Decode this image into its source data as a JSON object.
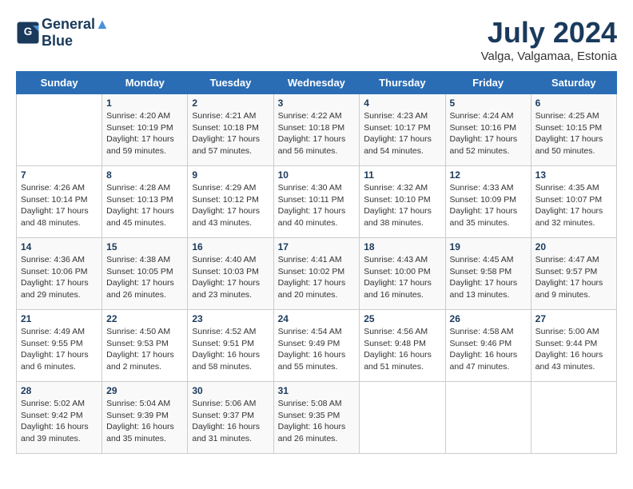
{
  "header": {
    "logo_line1": "General",
    "logo_line2": "Blue",
    "month_year": "July 2024",
    "location": "Valga, Valgamaa, Estonia"
  },
  "days_of_week": [
    "Sunday",
    "Monday",
    "Tuesday",
    "Wednesday",
    "Thursday",
    "Friday",
    "Saturday"
  ],
  "weeks": [
    [
      {
        "num": "",
        "info": ""
      },
      {
        "num": "1",
        "info": "Sunrise: 4:20 AM\nSunset: 10:19 PM\nDaylight: 17 hours\nand 59 minutes."
      },
      {
        "num": "2",
        "info": "Sunrise: 4:21 AM\nSunset: 10:18 PM\nDaylight: 17 hours\nand 57 minutes."
      },
      {
        "num": "3",
        "info": "Sunrise: 4:22 AM\nSunset: 10:18 PM\nDaylight: 17 hours\nand 56 minutes."
      },
      {
        "num": "4",
        "info": "Sunrise: 4:23 AM\nSunset: 10:17 PM\nDaylight: 17 hours\nand 54 minutes."
      },
      {
        "num": "5",
        "info": "Sunrise: 4:24 AM\nSunset: 10:16 PM\nDaylight: 17 hours\nand 52 minutes."
      },
      {
        "num": "6",
        "info": "Sunrise: 4:25 AM\nSunset: 10:15 PM\nDaylight: 17 hours\nand 50 minutes."
      }
    ],
    [
      {
        "num": "7",
        "info": "Sunrise: 4:26 AM\nSunset: 10:14 PM\nDaylight: 17 hours\nand 48 minutes."
      },
      {
        "num": "8",
        "info": "Sunrise: 4:28 AM\nSunset: 10:13 PM\nDaylight: 17 hours\nand 45 minutes."
      },
      {
        "num": "9",
        "info": "Sunrise: 4:29 AM\nSunset: 10:12 PM\nDaylight: 17 hours\nand 43 minutes."
      },
      {
        "num": "10",
        "info": "Sunrise: 4:30 AM\nSunset: 10:11 PM\nDaylight: 17 hours\nand 40 minutes."
      },
      {
        "num": "11",
        "info": "Sunrise: 4:32 AM\nSunset: 10:10 PM\nDaylight: 17 hours\nand 38 minutes."
      },
      {
        "num": "12",
        "info": "Sunrise: 4:33 AM\nSunset: 10:09 PM\nDaylight: 17 hours\nand 35 minutes."
      },
      {
        "num": "13",
        "info": "Sunrise: 4:35 AM\nSunset: 10:07 PM\nDaylight: 17 hours\nand 32 minutes."
      }
    ],
    [
      {
        "num": "14",
        "info": "Sunrise: 4:36 AM\nSunset: 10:06 PM\nDaylight: 17 hours\nand 29 minutes."
      },
      {
        "num": "15",
        "info": "Sunrise: 4:38 AM\nSunset: 10:05 PM\nDaylight: 17 hours\nand 26 minutes."
      },
      {
        "num": "16",
        "info": "Sunrise: 4:40 AM\nSunset: 10:03 PM\nDaylight: 17 hours\nand 23 minutes."
      },
      {
        "num": "17",
        "info": "Sunrise: 4:41 AM\nSunset: 10:02 PM\nDaylight: 17 hours\nand 20 minutes."
      },
      {
        "num": "18",
        "info": "Sunrise: 4:43 AM\nSunset: 10:00 PM\nDaylight: 17 hours\nand 16 minutes."
      },
      {
        "num": "19",
        "info": "Sunrise: 4:45 AM\nSunset: 9:58 PM\nDaylight: 17 hours\nand 13 minutes."
      },
      {
        "num": "20",
        "info": "Sunrise: 4:47 AM\nSunset: 9:57 PM\nDaylight: 17 hours\nand 9 minutes."
      }
    ],
    [
      {
        "num": "21",
        "info": "Sunrise: 4:49 AM\nSunset: 9:55 PM\nDaylight: 17 hours\nand 6 minutes."
      },
      {
        "num": "22",
        "info": "Sunrise: 4:50 AM\nSunset: 9:53 PM\nDaylight: 17 hours\nand 2 minutes."
      },
      {
        "num": "23",
        "info": "Sunrise: 4:52 AM\nSunset: 9:51 PM\nDaylight: 16 hours\nand 58 minutes."
      },
      {
        "num": "24",
        "info": "Sunrise: 4:54 AM\nSunset: 9:49 PM\nDaylight: 16 hours\nand 55 minutes."
      },
      {
        "num": "25",
        "info": "Sunrise: 4:56 AM\nSunset: 9:48 PM\nDaylight: 16 hours\nand 51 minutes."
      },
      {
        "num": "26",
        "info": "Sunrise: 4:58 AM\nSunset: 9:46 PM\nDaylight: 16 hours\nand 47 minutes."
      },
      {
        "num": "27",
        "info": "Sunrise: 5:00 AM\nSunset: 9:44 PM\nDaylight: 16 hours\nand 43 minutes."
      }
    ],
    [
      {
        "num": "28",
        "info": "Sunrise: 5:02 AM\nSunset: 9:42 PM\nDaylight: 16 hours\nand 39 minutes."
      },
      {
        "num": "29",
        "info": "Sunrise: 5:04 AM\nSunset: 9:39 PM\nDaylight: 16 hours\nand 35 minutes."
      },
      {
        "num": "30",
        "info": "Sunrise: 5:06 AM\nSunset: 9:37 PM\nDaylight: 16 hours\nand 31 minutes."
      },
      {
        "num": "31",
        "info": "Sunrise: 5:08 AM\nSunset: 9:35 PM\nDaylight: 16 hours\nand 26 minutes."
      },
      {
        "num": "",
        "info": ""
      },
      {
        "num": "",
        "info": ""
      },
      {
        "num": "",
        "info": ""
      }
    ]
  ]
}
